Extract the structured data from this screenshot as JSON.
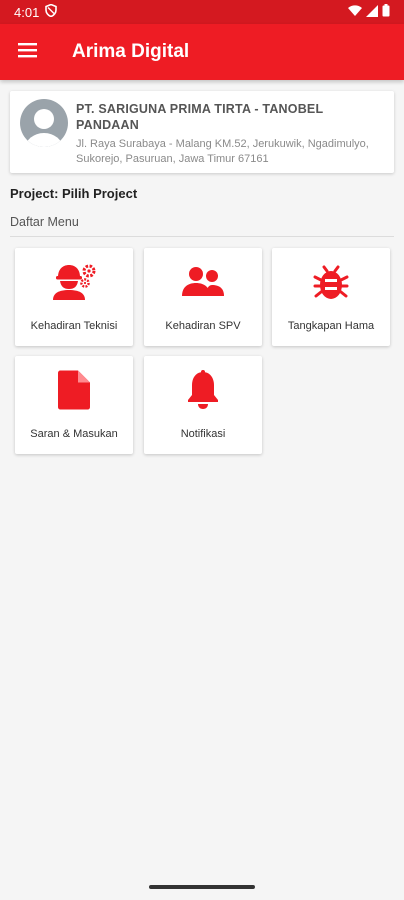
{
  "status_bar": {
    "time": "4:01",
    "icons": [
      "shield-icon",
      "wifi-icon",
      "signal-icon",
      "battery-icon"
    ]
  },
  "app_bar": {
    "title": "Arima Digital",
    "menu_icon": "hamburger-menu-icon"
  },
  "profile": {
    "company_name": "PT. SARIGUNA PRIMA TIRTA - TANOBEL PANDAAN",
    "address": "Jl. Raya Surabaya - Malang KM.52, Jerukuwik, Ngadimulyo, Sukorejo, Pasuruan, Jawa Timur 67161"
  },
  "project": {
    "label": "Project: Pilih Project"
  },
  "menu": {
    "heading": "Daftar Menu",
    "items": [
      {
        "label": "Kehadiran Teknisi",
        "icon": "technician-gear-icon"
      },
      {
        "label": "Kehadiran SPV",
        "icon": "users-icon"
      },
      {
        "label": "Tangkapan Hama",
        "icon": "bug-icon"
      },
      {
        "label": "Saran & Masukan",
        "icon": "document-icon"
      },
      {
        "label": "Notifikasi",
        "icon": "bell-icon"
      }
    ]
  },
  "colors": {
    "primary": "#ee1c24",
    "status_bar": "#d41920",
    "background": "#f5f5f5"
  }
}
